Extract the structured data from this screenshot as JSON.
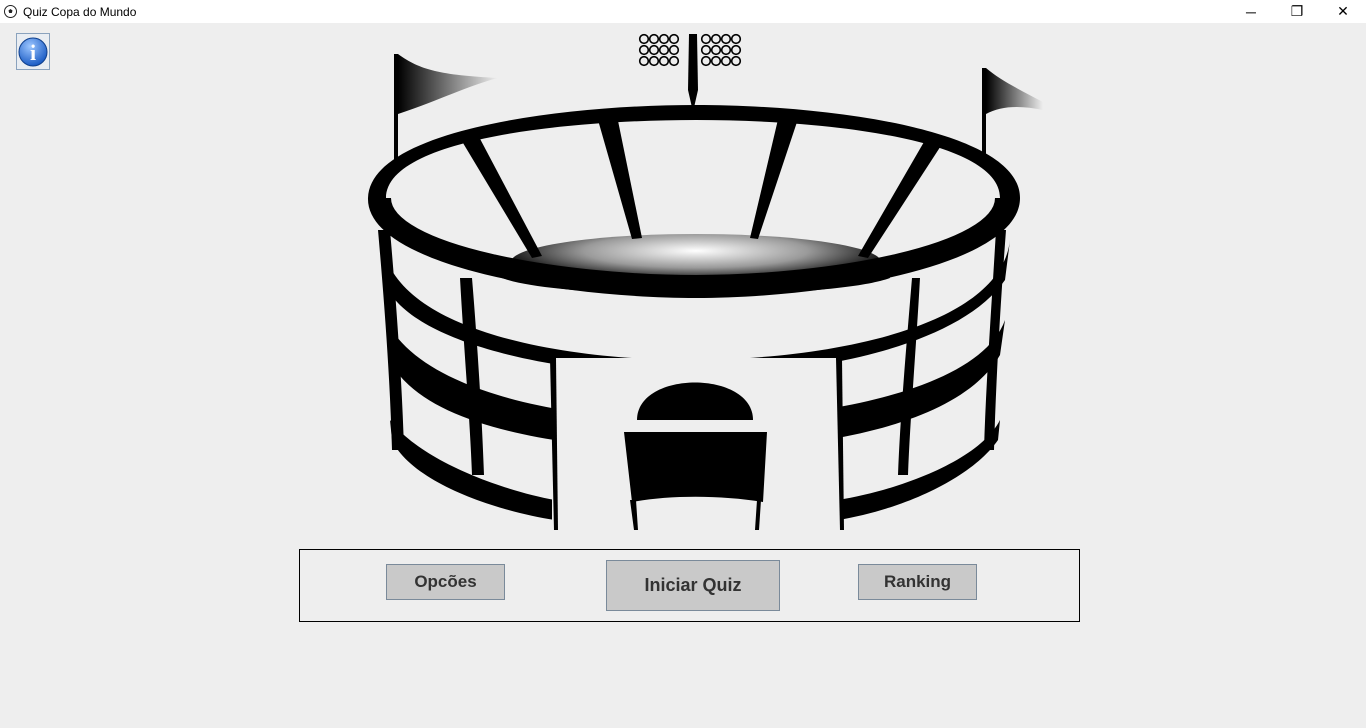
{
  "window": {
    "title": "Quiz Copa do Mundo",
    "controls": [
      "minimize-icon",
      "restore-icon",
      "close-icon"
    ],
    "minimize_glyph": "─",
    "restore_glyph": "❐",
    "close_glyph": "✕"
  },
  "info_button": {
    "icon": "info-icon",
    "glyph": "i"
  },
  "illustration": {
    "icon": "stadium-icon"
  },
  "menu": {
    "options_label": "Opcões",
    "start_label": "Iniciar Quiz",
    "ranking_label": "Ranking"
  },
  "colors": {
    "background": "#eeeeee",
    "button": "#c9c9c9",
    "button_text": "#333333"
  }
}
